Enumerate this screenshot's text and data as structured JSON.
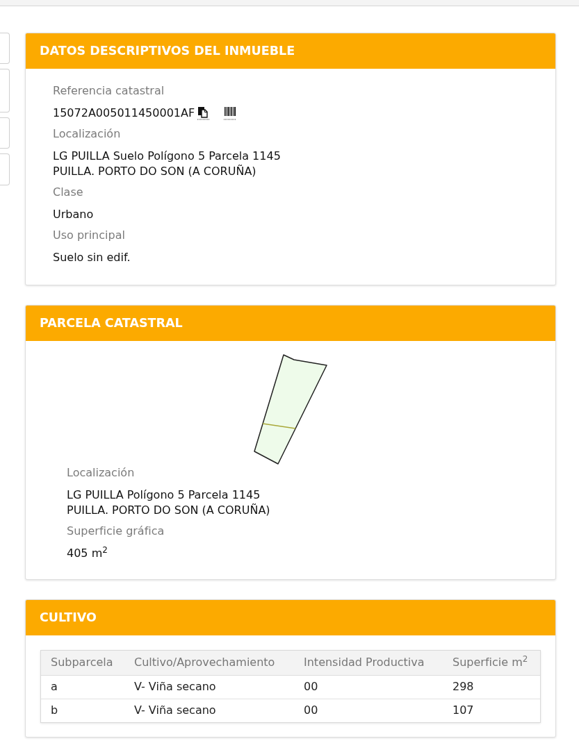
{
  "sections": [
    {
      "kind": "fields",
      "title": "DATOS DESCRIPTIVOS DEL INMUEBLE",
      "fields": [
        {
          "kind": "reference",
          "label": "Referencia catastral",
          "lines": [
            "15072A005011450001AF"
          ]
        },
        {
          "kind": "text",
          "label": "Localización",
          "lines": [
            "LG PUILLA Suelo Polígono 5 Parcela 1145",
            "PUILLA. PORTO DO SON (A CORUÑA)"
          ]
        },
        {
          "kind": "text",
          "label": "Clase",
          "lines": [
            "Urbano"
          ]
        },
        {
          "kind": "text",
          "label": "Uso principal",
          "lines": [
            "Suelo sin edif."
          ]
        }
      ]
    },
    {
      "kind": "parcel",
      "title": "PARCELA CATASTRAL",
      "fields": [
        {
          "kind": "text",
          "label": "Localización",
          "lines": [
            "LG PUILLA Polígono 5 Parcela 1145",
            "PUILLA. PORTO DO SON (A CORUÑA)"
          ]
        },
        {
          "kind": "text",
          "label": "Superficie gráfica",
          "lines": [
            "405 m$^{2}$"
          ]
        }
      ]
    },
    {
      "kind": "table",
      "title": "CULTIVO",
      "table": {
        "columns": [
          "Subparcela",
          "Cultivo/Aprovechamiento",
          "Intensidad Productiva",
          "Superficie m$^{2}$"
        ],
        "rows": [
          [
            "a",
            "V- Viña secano",
            "00",
            "298"
          ],
          [
            "b",
            "V- Viña secano",
            "00",
            "107"
          ]
        ]
      }
    }
  ]
}
